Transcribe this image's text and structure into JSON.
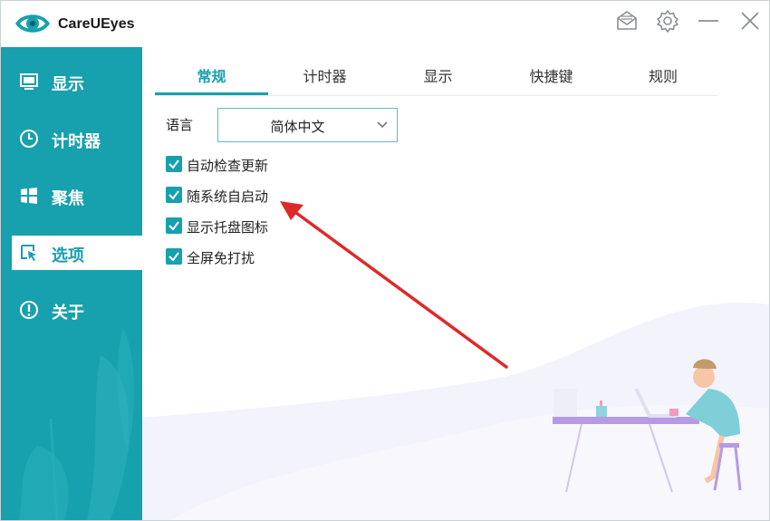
{
  "app": {
    "title": "CareUEyes"
  },
  "titlebar": {
    "icons": [
      "mail-icon",
      "gear-icon",
      "minimize-icon",
      "close-icon"
    ]
  },
  "sidebar": {
    "items": [
      {
        "label": "显示",
        "icon": "monitor-icon",
        "active": false
      },
      {
        "label": "计时器",
        "icon": "clock-icon",
        "active": false
      },
      {
        "label": "聚焦",
        "icon": "windows-icon",
        "active": false
      },
      {
        "label": "选项",
        "icon": "cursor-icon",
        "active": true
      },
      {
        "label": "关于",
        "icon": "info-icon",
        "active": false
      }
    ]
  },
  "tabs": [
    {
      "label": "常规",
      "active": true
    },
    {
      "label": "计时器",
      "active": false
    },
    {
      "label": "显示",
      "active": false
    },
    {
      "label": "快捷键",
      "active": false
    },
    {
      "label": "规则",
      "active": false
    }
  ],
  "general": {
    "language_label": "语言",
    "language_value": "简体中文",
    "options": [
      {
        "label": "自动检查更新",
        "checked": true
      },
      {
        "label": "随系统自启动",
        "checked": true
      },
      {
        "label": "显示托盘图标",
        "checked": true
      },
      {
        "label": "全屏免打扰",
        "checked": true
      }
    ]
  },
  "colors": {
    "accent": "#17a0ad",
    "annotation_arrow": "#e02828"
  }
}
